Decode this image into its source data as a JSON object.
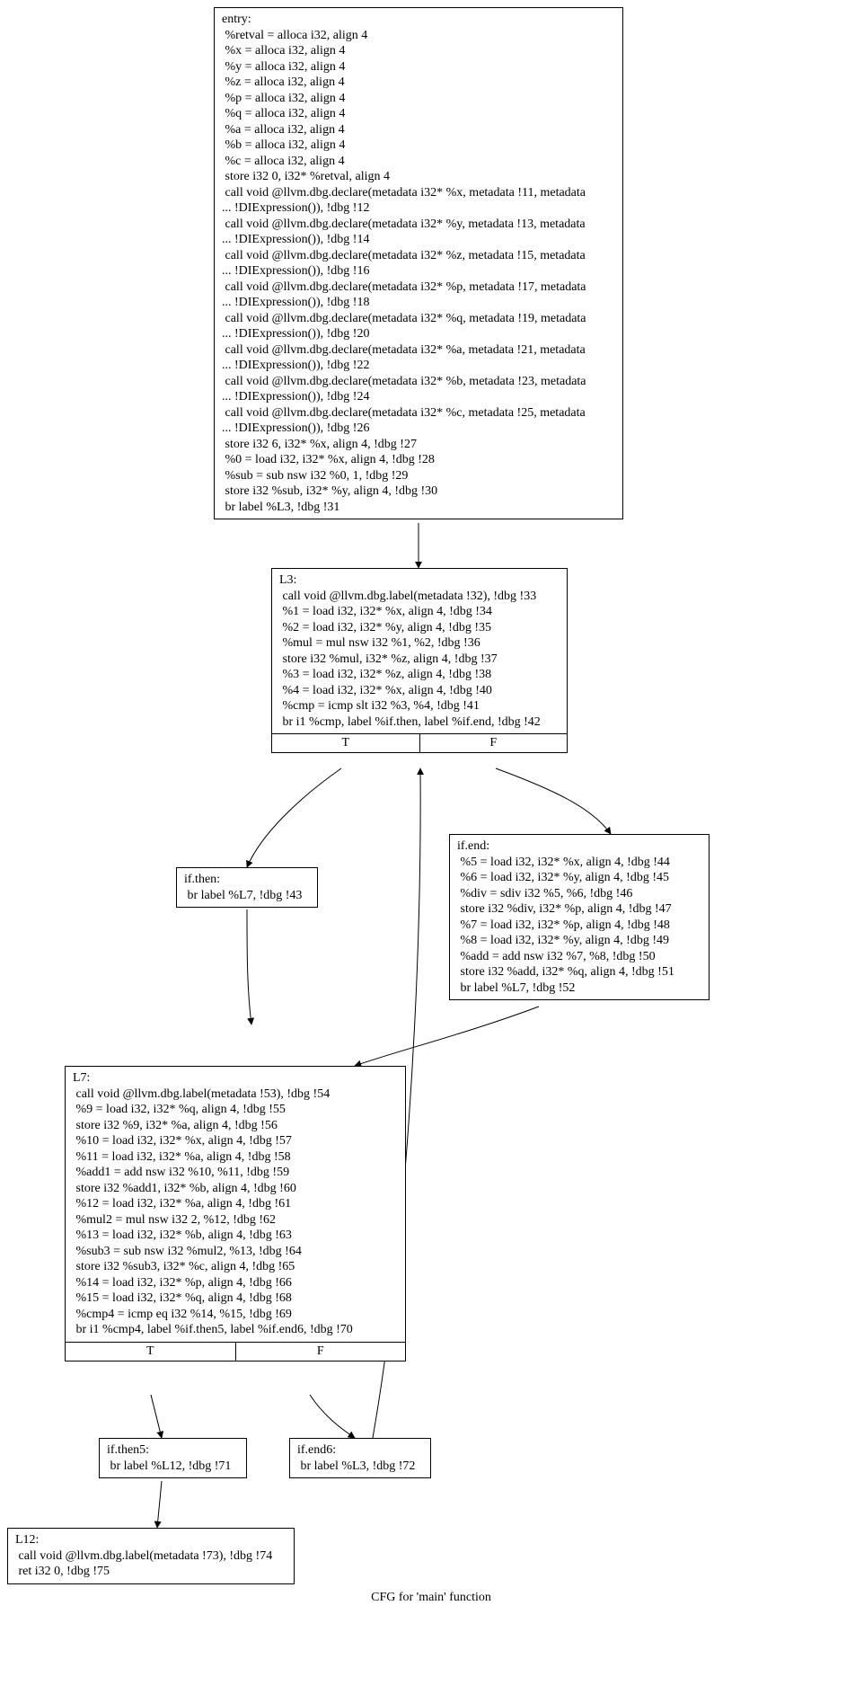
{
  "caption": "CFG for 'main' function",
  "branch_labels": {
    "true": "T",
    "false": "F"
  },
  "nodes": {
    "entry": {
      "lines": [
        "entry:",
        " %retval = alloca i32, align 4",
        " %x = alloca i32, align 4",
        " %y = alloca i32, align 4",
        " %z = alloca i32, align 4",
        " %p = alloca i32, align 4",
        " %q = alloca i32, align 4",
        " %a = alloca i32, align 4",
        " %b = alloca i32, align 4",
        " %c = alloca i32, align 4",
        " store i32 0, i32* %retval, align 4",
        " call void @llvm.dbg.declare(metadata i32* %x, metadata !11, metadata",
        "... !DIExpression()), !dbg !12",
        " call void @llvm.dbg.declare(metadata i32* %y, metadata !13, metadata",
        "... !DIExpression()), !dbg !14",
        " call void @llvm.dbg.declare(metadata i32* %z, metadata !15, metadata",
        "... !DIExpression()), !dbg !16",
        " call void @llvm.dbg.declare(metadata i32* %p, metadata !17, metadata",
        "... !DIExpression()), !dbg !18",
        " call void @llvm.dbg.declare(metadata i32* %q, metadata !19, metadata",
        "... !DIExpression()), !dbg !20",
        " call void @llvm.dbg.declare(metadata i32* %a, metadata !21, metadata",
        "... !DIExpression()), !dbg !22",
        " call void @llvm.dbg.declare(metadata i32* %b, metadata !23, metadata",
        "... !DIExpression()), !dbg !24",
        " call void @llvm.dbg.declare(metadata i32* %c, metadata !25, metadata",
        "... !DIExpression()), !dbg !26",
        " store i32 6, i32* %x, align 4, !dbg !27",
        " %0 = load i32, i32* %x, align 4, !dbg !28",
        " %sub = sub nsw i32 %0, 1, !dbg !29",
        " store i32 %sub, i32* %y, align 4, !dbg !30",
        " br label %L3, !dbg !31"
      ]
    },
    "L3": {
      "lines": [
        "L3:",
        " call void @llvm.dbg.label(metadata !32), !dbg !33",
        " %1 = load i32, i32* %x, align 4, !dbg !34",
        " %2 = load i32, i32* %y, align 4, !dbg !35",
        " %mul = mul nsw i32 %1, %2, !dbg !36",
        " store i32 %mul, i32* %z, align 4, !dbg !37",
        " %3 = load i32, i32* %z, align 4, !dbg !38",
        " %4 = load i32, i32* %x, align 4, !dbg !40",
        " %cmp = icmp slt i32 %3, %4, !dbg !41",
        " br i1 %cmp, label %if.then, label %if.end, !dbg !42"
      ],
      "has_branches": true
    },
    "if_then": {
      "lines": [
        "if.then:",
        " br label %L7, !dbg !43"
      ]
    },
    "if_end": {
      "lines": [
        "if.end:",
        " %5 = load i32, i32* %x, align 4, !dbg !44",
        " %6 = load i32, i32* %y, align 4, !dbg !45",
        " %div = sdiv i32 %5, %6, !dbg !46",
        " store i32 %div, i32* %p, align 4, !dbg !47",
        " %7 = load i32, i32* %p, align 4, !dbg !48",
        " %8 = load i32, i32* %y, align 4, !dbg !49",
        " %add = add nsw i32 %7, %8, !dbg !50",
        " store i32 %add, i32* %q, align 4, !dbg !51",
        " br label %L7, !dbg !52"
      ]
    },
    "L7": {
      "lines": [
        "L7:",
        " call void @llvm.dbg.label(metadata !53), !dbg !54",
        " %9 = load i32, i32* %q, align 4, !dbg !55",
        " store i32 %9, i32* %a, align 4, !dbg !56",
        " %10 = load i32, i32* %x, align 4, !dbg !57",
        " %11 = load i32, i32* %a, align 4, !dbg !58",
        " %add1 = add nsw i32 %10, %11, !dbg !59",
        " store i32 %add1, i32* %b, align 4, !dbg !60",
        " %12 = load i32, i32* %a, align 4, !dbg !61",
        " %mul2 = mul nsw i32 2, %12, !dbg !62",
        " %13 = load i32, i32* %b, align 4, !dbg !63",
        " %sub3 = sub nsw i32 %mul2, %13, !dbg !64",
        " store i32 %sub3, i32* %c, align 4, !dbg !65",
        " %14 = load i32, i32* %p, align 4, !dbg !66",
        " %15 = load i32, i32* %q, align 4, !dbg !68",
        " %cmp4 = icmp eq i32 %14, %15, !dbg !69",
        " br i1 %cmp4, label %if.then5, label %if.end6, !dbg !70"
      ],
      "has_branches": true
    },
    "if_then5": {
      "lines": [
        "if.then5:",
        " br label %L12, !dbg !71"
      ]
    },
    "if_end6": {
      "lines": [
        "if.end6:",
        " br label %L3, !dbg !72"
      ]
    },
    "L12": {
      "lines": [
        "L12:",
        " call void @llvm.dbg.label(metadata !73), !dbg !74",
        " ret i32 0, !dbg !75"
      ]
    }
  }
}
